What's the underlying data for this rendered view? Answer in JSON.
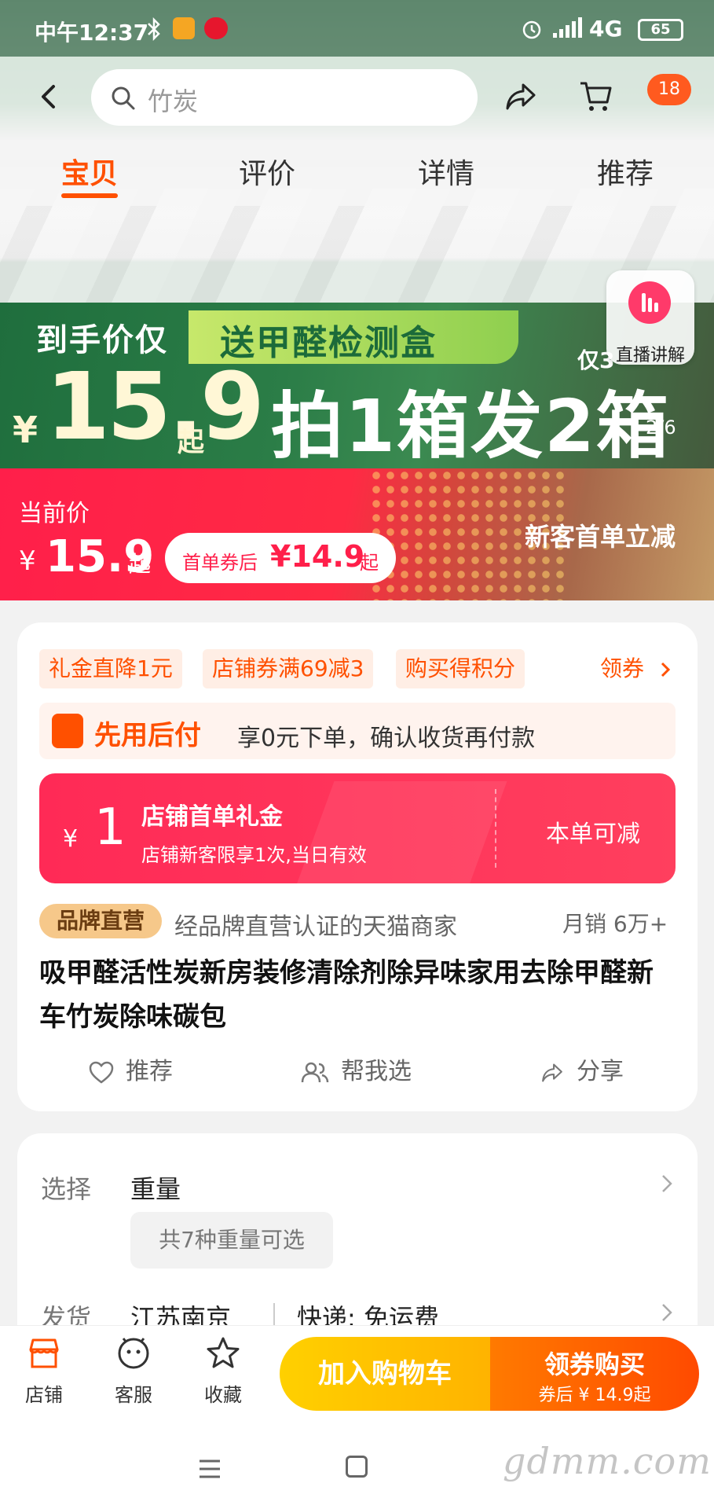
{
  "status_bar": {
    "time": "中午12:37",
    "network": "4G",
    "battery": "65"
  },
  "header": {
    "search_placeholder": "竹炭",
    "message_count": "18"
  },
  "tabs": [
    {
      "label": "宝贝"
    },
    {
      "label": "评价"
    },
    {
      "label": "详情"
    },
    {
      "label": "推荐"
    }
  ],
  "hero": {
    "promo_label": "到手价仅",
    "promo_price_symbol": "¥",
    "promo_price": "15.9",
    "promo_price_suffix": "起",
    "gift_text": "送甲醛检测盒",
    "main_promo": "拍1箱发2箱",
    "side_text": "仅3",
    "live_label": "直播讲解",
    "slide_indicator": "2/6"
  },
  "price": {
    "label": "当前价",
    "symbol": "¥",
    "value": "15.9",
    "suffix": "起",
    "coupon_label": "首单券后",
    "coupon_value": "¥14.9",
    "coupon_suffix": "起",
    "slogan": "新客首单立减"
  },
  "promos": {
    "tags": [
      {
        "label": "礼金直降1元"
      },
      {
        "label": "店铺券满69减3"
      },
      {
        "label": "购买得积分"
      }
    ],
    "get_coupon": "领券"
  },
  "pay_later": {
    "title": "先用后付",
    "desc": "享0元下单，确认收货再付款"
  },
  "gift_card": {
    "symbol": "¥",
    "amount": "1",
    "title": "店铺首单礼金",
    "desc": "店铺新客限享1次,当日有效",
    "action": "本单可减"
  },
  "brand": {
    "badge": "品牌直营",
    "desc": "经品牌直营认证的天猫商家",
    "monthly_sales": "月销 6万+"
  },
  "product": {
    "title": "吸甲醛活性炭新房装修清除剂除异味家用去除甲醛新车竹炭除味碳包"
  },
  "actions": [
    {
      "label": "推荐"
    },
    {
      "label": "帮我选"
    },
    {
      "label": "分享"
    }
  ],
  "spec": {
    "select_label": "选择",
    "select_value": "重量",
    "select_chip": "共7种重量可选",
    "ship_label": "发货",
    "ship_from": "江苏南京",
    "ship_fee": "快递: 免运费"
  },
  "bottom_bar": {
    "items": [
      {
        "label": "店铺"
      },
      {
        "label": "客服"
      },
      {
        "label": "收藏"
      }
    ],
    "add_cart": "加入购物车",
    "buy_now": "领券购买",
    "buy_now_sub": "券后 ¥ 14.9起"
  },
  "watermark": "gdmm.com",
  "colors": {
    "accent": "#ff5000",
    "price_red": "#ff1f4a",
    "gift_pink": "#ff2a56",
    "cart_yellow": "#ffc300",
    "buy_orange": "#ff5a00"
  }
}
